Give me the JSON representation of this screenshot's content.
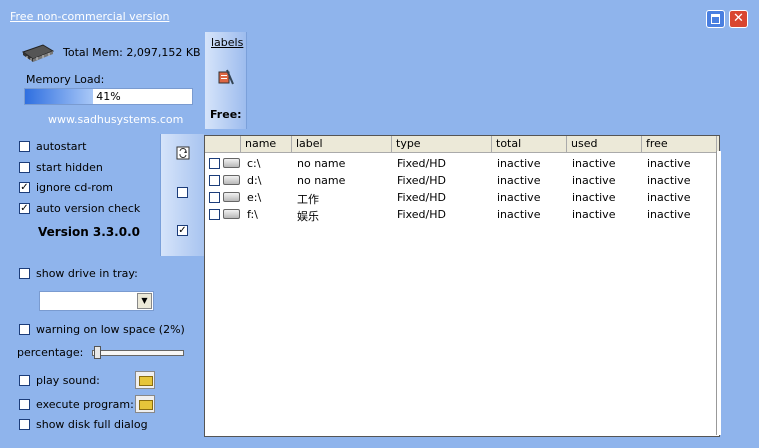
{
  "titlebar": {
    "link": "Free non-commercial version"
  },
  "memory": {
    "total_label": "Total Mem: 2,097,152 KB",
    "load_label": "Memory Load:",
    "load_percent_text": "41%",
    "load_value": 0.41
  },
  "website": "www.sadhusystems.com",
  "options": [
    {
      "label": "autostart",
      "checked": false
    },
    {
      "label": "start hidden",
      "checked": false
    },
    {
      "label": "ignore cd-rom",
      "checked": true
    },
    {
      "label": "auto version check",
      "checked": true
    }
  ],
  "version": "Version 3.3.0.0",
  "tray": {
    "label": "show drive in tray:",
    "checked": false,
    "selected": ""
  },
  "warning": {
    "label": "warning on low space (2%)",
    "checked": false
  },
  "percentage": {
    "label": "percentage:",
    "value": 0.02
  },
  "actions": [
    {
      "label": "play sound:",
      "checked": false
    },
    {
      "label": "execute program:",
      "checked": false
    },
    {
      "label": "show disk full dialog",
      "checked": false
    }
  ],
  "labels_panel": {
    "link": "labels",
    "free": "Free:"
  },
  "toolstrip": {
    "icons": [
      "refresh-icon",
      "uncheck-all-icon",
      "check-all-icon"
    ]
  },
  "table": {
    "headers": [
      "name",
      "label",
      "type",
      "total",
      "used",
      "free"
    ],
    "rows": [
      {
        "name": "c:\\",
        "label": "no name",
        "type": "Fixed/HD",
        "total": "inactive",
        "used": "inactive",
        "free": "inactive"
      },
      {
        "name": "d:\\",
        "label": "no name",
        "type": "Fixed/HD",
        "total": "inactive",
        "used": "inactive",
        "free": "inactive"
      },
      {
        "name": "e:\\",
        "label": "工作",
        "type": "Fixed/HD",
        "total": "inactive",
        "used": "inactive",
        "free": "inactive"
      },
      {
        "name": "f:\\",
        "label": "娱乐",
        "type": "Fixed/HD",
        "total": "inactive",
        "used": "inactive",
        "free": "inactive"
      }
    ]
  },
  "colors": {
    "window_bg": "#8fb4ec",
    "progress": "#2f6fe0",
    "close": "#d9462f"
  }
}
